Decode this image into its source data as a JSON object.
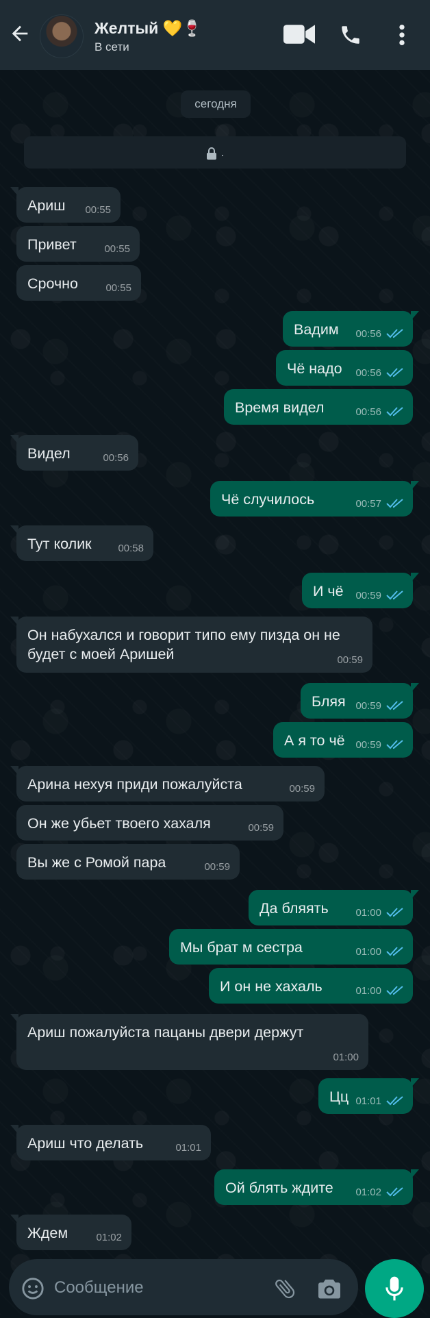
{
  "header": {
    "contact_name": "Желтый 💛🍷",
    "status": "В сети",
    "icons": [
      "back-arrow-icon",
      "video-call-icon",
      "phone-call-icon",
      "more-vert-icon"
    ]
  },
  "colors": {
    "header_bg": "#1f2c34",
    "chat_bg": "#0b141a",
    "incoming_bubble": "#202c33",
    "outgoing_bubble": "#005c4b",
    "read_ticks": "#53bdeb",
    "accent": "#00a884"
  },
  "date_chip": "сегодня",
  "info_card": ".",
  "messages": [
    {
      "dir": "in",
      "text": "Ариш",
      "time": "00:55"
    },
    {
      "dir": "in",
      "text": "Привет",
      "time": "00:55"
    },
    {
      "dir": "in",
      "text": "Срочно",
      "time": "00:55"
    },
    {
      "dir": "out",
      "text": "Вадим",
      "time": "00:56",
      "read": true
    },
    {
      "dir": "out",
      "text": "Чё надо",
      "time": "00:56",
      "read": true
    },
    {
      "dir": "out",
      "text": "Время видел",
      "time": "00:56",
      "read": true
    },
    {
      "dir": "in",
      "text": "Видел",
      "time": "00:56"
    },
    {
      "dir": "out",
      "text": "Чё случилось",
      "time": "00:57",
      "read": true
    },
    {
      "dir": "in",
      "text": "Тут колик",
      "time": "00:58"
    },
    {
      "dir": "out",
      "text": "И чё",
      "time": "00:59",
      "read": true
    },
    {
      "dir": "in",
      "text": "Он набухался и говорит типо ему пизда он не будет с моей Аришей",
      "time": "00:59"
    },
    {
      "dir": "out",
      "text": "Бляя",
      "time": "00:59",
      "read": true
    },
    {
      "dir": "out",
      "text": "А я то чё",
      "time": "00:59",
      "read": true
    },
    {
      "dir": "in",
      "text": "Арина нехуя приди пожалуйста",
      "time": "00:59"
    },
    {
      "dir": "in",
      "text": "Он же убьет твоего хахаля",
      "time": "00:59"
    },
    {
      "dir": "in",
      "text": "Вы же с Ромой пара",
      "time": "00:59"
    },
    {
      "dir": "out",
      "text": "Да бляять",
      "time": "01:00",
      "read": true
    },
    {
      "dir": "out",
      "text": "Мы брат м сестра",
      "time": "01:00",
      "read": true
    },
    {
      "dir": "out",
      "text": "И он не хахаль",
      "time": "01:00",
      "read": true
    },
    {
      "dir": "in",
      "text": "Ариш пожалуйста пацаны двери держут",
      "time": "01:00"
    },
    {
      "dir": "out",
      "text": "Цц",
      "time": "01:01",
      "read": true
    },
    {
      "dir": "in",
      "text": "Ариш что делать",
      "time": "01:01"
    },
    {
      "dir": "out",
      "text": "Ой блять ждите",
      "time": "01:02",
      "read": true
    },
    {
      "dir": "in",
      "text": "Ждем",
      "time": "01:02"
    }
  ],
  "composer": {
    "placeholder": "Сообщение",
    "icons": [
      "emoji-icon",
      "attach-icon",
      "camera-icon",
      "mic-icon"
    ]
  }
}
